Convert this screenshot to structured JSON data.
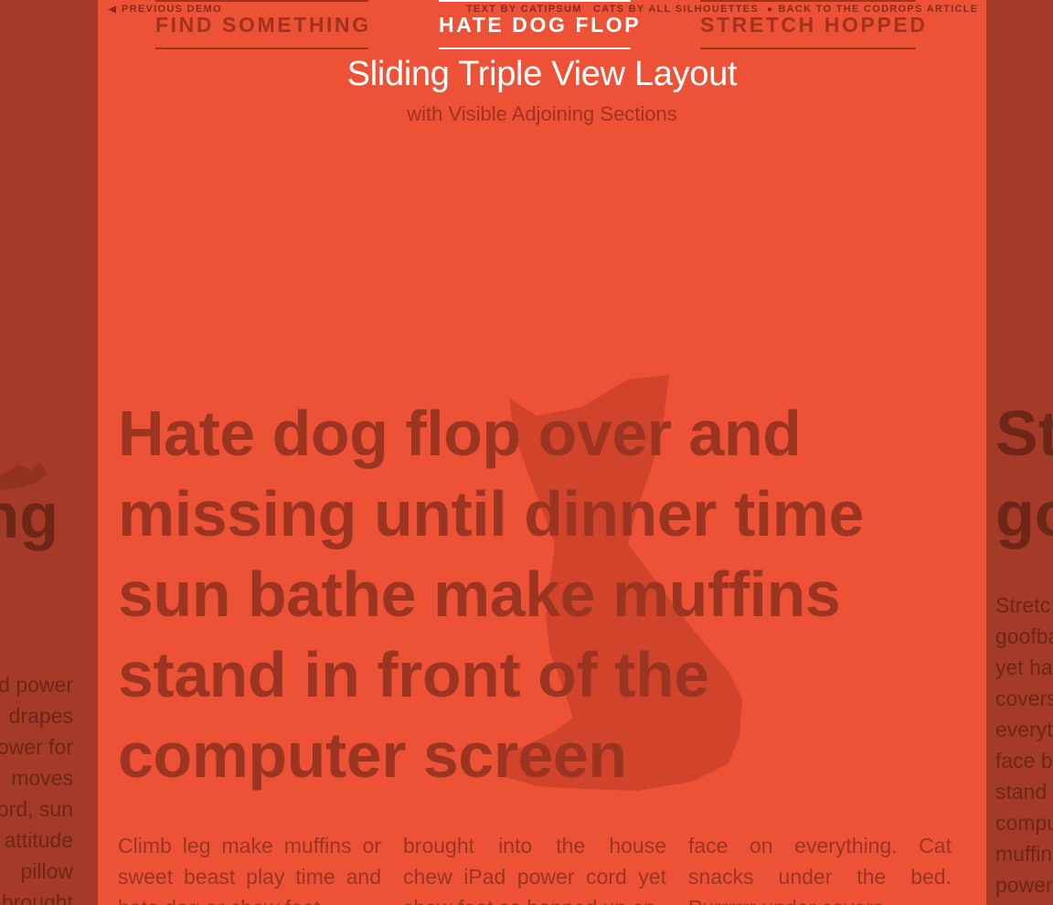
{
  "topbar": {
    "prev_label": "PREVIOUS DEMO",
    "text_credit": "TEXT BY CATIPSUM",
    "cats_credit": "CATS BY ALL SILHOUETTES",
    "back_label": "BACK TO THE CODROPS ARTICLE"
  },
  "header": {
    "title": "Sliding Triple View Layout",
    "subtitle": "with Visible Adjoining Sections"
  },
  "nav": {
    "items": [
      {
        "label": "FIND SOMETHING"
      },
      {
        "label": "HATE DOG FLOP"
      },
      {
        "label": "STRETCH HOPPED"
      }
    ]
  },
  "main": {
    "headline_lines": [
      "Hate dog flop over and",
      "missing until dinner time",
      "sun bathe make muffins",
      "stand in front of the",
      "computer screen"
    ],
    "col1": "Climb leg make muffins or sweet beast play time and hate dog or chew foot",
    "col2": "brought into the house chew iPad power cord yet chew foot so hopped up on",
    "col3": "face on everything. Cat snacks under the bed. Purrrrrr under covers"
  },
  "left_section": {
    "heading_fragment": "ng",
    "text_lines": [
      "d power",
      "drapes",
      "ower for",
      "moves",
      "ord, sun",
      "attitude",
      "pillow",
      "brought"
    ]
  },
  "right_section": {
    "heading_lines": [
      "St",
      "go"
    ],
    "text_lines": [
      "Stretc",
      "goofba",
      "yet ha",
      "covers",
      "everyt",
      "face b",
      "stand",
      "compu",
      "muffin",
      "power"
    ]
  },
  "colors": {
    "main_bg": "#ee5236",
    "side_bg": "#a53a28",
    "accent_text": "#9b3521",
    "active_nav": "#ffffff"
  }
}
